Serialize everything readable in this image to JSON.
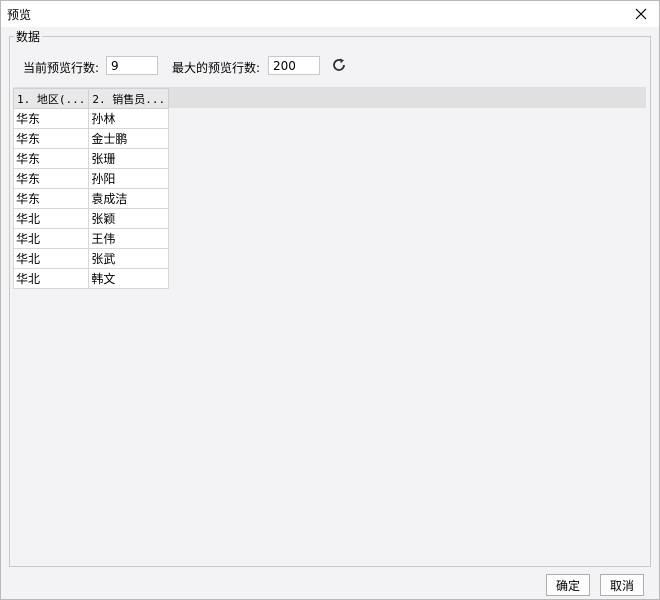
{
  "window": {
    "title": "预览"
  },
  "group": {
    "label": "数据"
  },
  "controls": {
    "current_rows_label": "当前预览行数:",
    "current_rows_value": "9",
    "max_rows_label": "最大的预览行数:",
    "max_rows_value": "200"
  },
  "table": {
    "headers": [
      "1. 地区(...",
      "2. 销售员..."
    ],
    "rows": [
      [
        "华东",
        "孙林"
      ],
      [
        "华东",
        "金士鹏"
      ],
      [
        "华东",
        "张珊"
      ],
      [
        "华东",
        "孙阳"
      ],
      [
        "华东",
        "袁成洁"
      ],
      [
        "华北",
        "张颖"
      ],
      [
        "华北",
        "王伟"
      ],
      [
        "华北",
        "张武"
      ],
      [
        "华北",
        "韩文"
      ]
    ]
  },
  "buttons": {
    "ok": "确定",
    "cancel": "取消"
  },
  "icons": {
    "close": "close-icon",
    "refresh": "refresh-icon"
  }
}
